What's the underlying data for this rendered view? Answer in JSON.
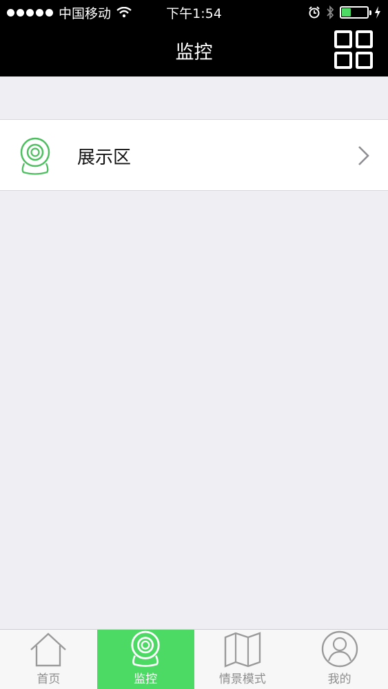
{
  "status_bar": {
    "carrier": "中国移动",
    "time": "下午1:54",
    "battery_percent": 35
  },
  "nav": {
    "title": "监控",
    "grid_icon": "grid-icon"
  },
  "list": {
    "items": [
      {
        "label": "展示区",
        "icon": "camera-icon"
      }
    ]
  },
  "tabbar": {
    "tabs": [
      {
        "label": "首页",
        "icon": "home-icon"
      },
      {
        "label": "监控",
        "icon": "camera-icon",
        "active": true
      },
      {
        "label": "情景模式",
        "icon": "map-icon"
      },
      {
        "label": "我的",
        "icon": "user-icon"
      }
    ]
  },
  "colors": {
    "accent": "#4cd964",
    "nav_background": "#000000",
    "page_background": "#efeef3"
  }
}
